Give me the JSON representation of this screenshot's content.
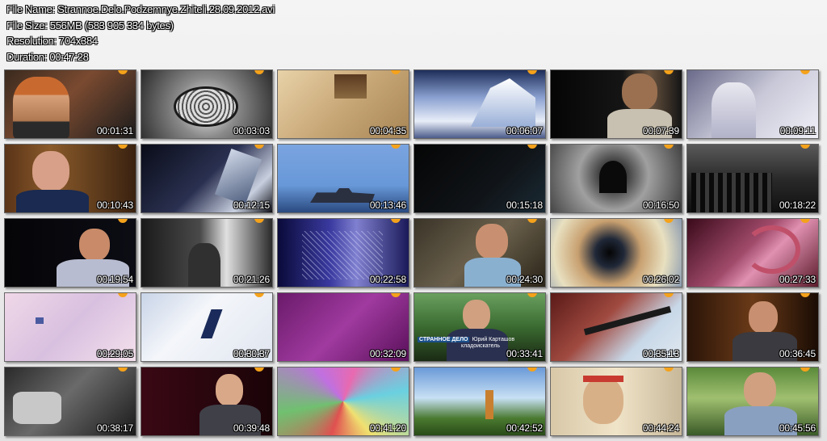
{
  "info": {
    "file_name": "File Name: Strannoe.Delo.Podzemnye.Zhiteli.28.09.2012.avi",
    "file_size": "File Size: 556MB (583 905 334 bytes)",
    "resolution": "Resolution: 704x384",
    "duration": "Duration: 00:47:28"
  },
  "colors": {
    "channel_logo": "#f5a21b"
  },
  "thumbnails": [
    {
      "time": "00:01:31",
      "bg": "linear-gradient(135deg,#3a2a1e 0%,#7a4a30 45%,#1c1c1c 100%)",
      "fig": "person-helmet"
    },
    {
      "time": "00:03:03",
      "bg": "radial-gradient(circle at 50% 55%,#f0f0f0 0%,#8a8a8a 40%,#2a2a2a 100%)",
      "fig": "tree-drawing"
    },
    {
      "time": "00:04:35",
      "bg": "linear-gradient(135deg,#e8d2a8 0%,#c9a878 50%,#a88656 100%)",
      "fig": "old-map"
    },
    {
      "time": "00:06:07",
      "bg": "linear-gradient(180deg,#1e2e5a 0%,#8aa0d0 40%,#e8eef8 75%,#4a5a8a 100%)",
      "fig": "iceberg"
    },
    {
      "time": "00:07:39",
      "bg": "linear-gradient(90deg,#050505 0%,#151515 55%,#6a5440 75%,#151515 100%)",
      "fig": "person-dark"
    },
    {
      "time": "00:09:11",
      "bg": "linear-gradient(135deg,#6a6a8a 0%,#c8c8d8 50%,#f0f0f8 100%)",
      "fig": "binoculars"
    },
    {
      "time": "00:10:43",
      "bg": "linear-gradient(90deg,#5a3418 0%,#8a5a2a 35%,#3a2210 100%)",
      "fig": "person-suit"
    },
    {
      "time": "00:12:15",
      "bg": "linear-gradient(135deg,#0a0c18 0%,#2a3050 50%,#c8d0e0 80%,#0c0c14 100%)",
      "fig": "dark-scene"
    },
    {
      "time": "00:13:46",
      "bg": "linear-gradient(180deg,#7aa4e0 0%,#6898d8 60%,#2a4a80 100%)",
      "fig": "ship"
    },
    {
      "time": "00:15:18",
      "bg": "linear-gradient(135deg,#050505 0%,#101418 60%,#1a2a34 100%)",
      "fig": "none"
    },
    {
      "time": "00:16:50",
      "bg": "radial-gradient(circle at 48% 45%,#101010 0%,#404040 18%,#a0a0a0 45%,#3a3a3a 100%)",
      "fig": "tunnel"
    },
    {
      "time": "00:18:22",
      "bg": "linear-gradient(180deg,#5a5a5a 0%,#2a2a2a 50%,#101010 100%)",
      "fig": "soldiers"
    },
    {
      "time": "00:19:54",
      "bg": "linear-gradient(90deg,#050508 0%,#0c0c14 100%)",
      "fig": "person-dark2"
    },
    {
      "time": "00:21:26",
      "bg": "linear-gradient(90deg,#1a1a1a 0%,#4a4a4a 45%,#e0e0e0 65%,#2a2a2a 100%)",
      "fig": "office-bw"
    },
    {
      "time": "00:22:58",
      "bg": "linear-gradient(90deg,#0a0a3a 0%,#3a3aa0 40%,#8080d0 60%,#1a1a5a 100%)",
      "fig": "net"
    },
    {
      "time": "00:24:30",
      "bg": "linear-gradient(135deg,#3a3428 0%,#6a604c 50%,#2a2418 100%)",
      "fig": "person-cave"
    },
    {
      "time": "00:26:02",
      "bg": "radial-gradient(circle at 45% 50%,#050505 0%,#202838 18%,#c8a070 40%,#e8e0c0 70%,#8a9ab0 100%)",
      "fig": "mine"
    },
    {
      "time": "00:27:33",
      "bg": "linear-gradient(135deg,#3a0a1a 0%,#a04a6a 45%,#e090b0 60%,#5a1a2a 100%)",
      "fig": "dragon"
    },
    {
      "time": "00:29:05",
      "bg": "linear-gradient(135deg,#f0d8e8 0%,#d8c0e0 50%,#f4e0ec 100%)",
      "fig": "pale"
    },
    {
      "time": "00:30:37",
      "bg": "linear-gradient(135deg,#c8d4e8 0%,#f4f6fa 40%,#e0e6f0 100%)",
      "fig": "sheet"
    },
    {
      "time": "00:32:09",
      "bg": "linear-gradient(135deg,#6a1a6a 0%,#a03aa0 50%,#5a105a 100%)",
      "fig": "none"
    },
    {
      "time": "00:33:41",
      "bg": "linear-gradient(180deg,#6aa060 0%,#3a6a30 50%,#1a2a14 100%)",
      "fig": "person-forest"
    },
    {
      "time": "00:35:13",
      "bg": "linear-gradient(135deg,#5a1a18 0%,#a04a40 40%,#c8d8e8 70%,#e0e8f0 100%)",
      "fig": "pipe"
    },
    {
      "time": "00:36:45",
      "bg": "linear-gradient(90deg,#2a1408 0%,#6a3a18 50%,#1a0c04 100%)",
      "fig": "person-museum"
    },
    {
      "time": "00:38:17",
      "bg": "linear-gradient(135deg,#2a2a2a 0%,#6a6a6a 45%,#1a1a1a 100%)",
      "fig": "bw-machine"
    },
    {
      "time": "00:39:48",
      "bg": "linear-gradient(90deg,#3a0814 0%,#1a0408 100%)",
      "fig": "person-red"
    },
    {
      "time": "00:41:20",
      "bg": "conic-gradient(from 20deg,#e86ab0,#6ad0e0,#f0e070,#e05050,#70c070,#c070e0,#e86ab0)",
      "fig": "collage"
    },
    {
      "time": "00:42:52",
      "bg": "linear-gradient(180deg,#6a9ad8 0%,#c8e0f4 45%,#4a7a30 75%,#2a4a18 100%)",
      "fig": "hill"
    },
    {
      "time": "00:44:24",
      "bg": "linear-gradient(90deg,#d8c8a8 0%,#f0e4c8 50%,#c8b89a 100%)",
      "fig": "person-arms"
    },
    {
      "time": "00:45:56",
      "bg": "linear-gradient(180deg,#5a8a3a 0%,#a0c070 45%,#3a5a28 100%)",
      "fig": "person-outdoor"
    }
  ],
  "lower_third": {
    "channel": "СТРАННОЕ ДЕЛО",
    "name": "Юрий Карташов",
    "title": "кладоискатель"
  }
}
